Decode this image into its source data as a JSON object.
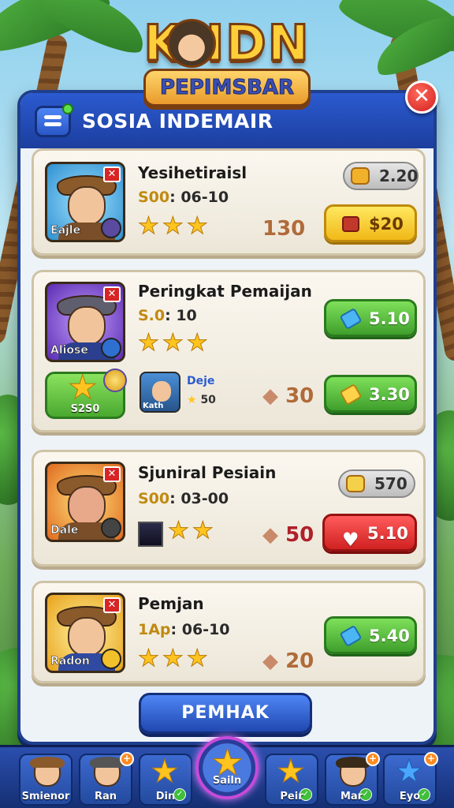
{
  "logo": {
    "title": "KHDN",
    "subtitle": "PEPIMSBAR"
  },
  "panel": {
    "title": "SOSIA INDEMAIR",
    "close_label": "✕"
  },
  "cards": [
    {
      "portrait_name": "Eajle",
      "name": "Yesihetiraisl",
      "stat_prefix": "S00",
      "stat_value": ": 06-10",
      "stars": "★★★",
      "mid_value": "130",
      "pill_value": "2.20",
      "button_label": "$20",
      "colors": {
        "portrait_bg": "#3fb8e8"
      }
    },
    {
      "portrait_name": "Aliose",
      "name": "Peringkat Pemaijan",
      "stat_prefix": "S.0",
      "stat_value": ": 10",
      "stars": "★★★",
      "button1_label": "5.10",
      "reward_label": "S2S0",
      "mini_name": "Deje",
      "mini_avatar_label": "Kath",
      "mini_value": "50",
      "mid_value": "30",
      "button2_label": "3.30",
      "colors": {
        "portrait_bg": "#7a4ad8"
      }
    },
    {
      "portrait_name": "Dale",
      "name": "Sjuniral Pesiain",
      "stat_prefix": "S00",
      "stat_value": ": 03-00",
      "stars": "★★",
      "mid_value": "50",
      "pill_value": "570",
      "button_label": "5.10",
      "colors": {
        "portrait_bg": "#f08a2a"
      }
    },
    {
      "portrait_name": "Radon",
      "name": "Pemjan",
      "stat_prefix": "1Ap",
      "stat_value": ": 06-10",
      "stars": "★★★",
      "mid_value": "20",
      "button_label": "5.40",
      "colors": {
        "portrait_bg": "#f5b62a"
      }
    }
  ],
  "main_button": "PEMHAK",
  "tabs": [
    {
      "label": "Smienor"
    },
    {
      "label": "Ran"
    },
    {
      "label": "Din"
    },
    {
      "label": "Sailn"
    },
    {
      "label": "Peir"
    },
    {
      "label": "Mar"
    },
    {
      "label": "Eyo"
    }
  ]
}
